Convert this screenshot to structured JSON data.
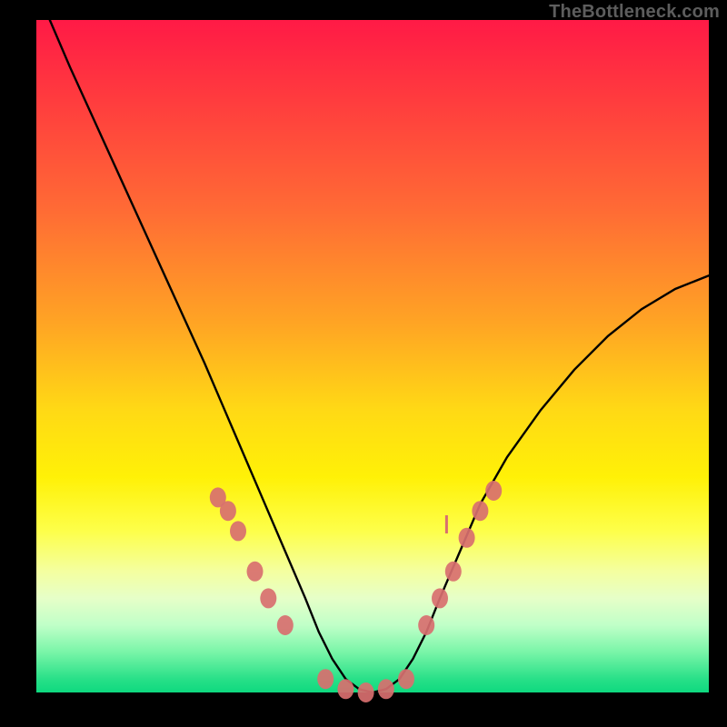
{
  "watermark": "TheBottleneck.com",
  "colors": {
    "frame": "#000000",
    "curve": "#000000",
    "marker": "#d86f6f",
    "gradient_top": "#ff1a46",
    "gradient_mid": "#ffe210",
    "gradient_bottom": "#0ed97f"
  },
  "chart_data": {
    "type": "line",
    "title": "",
    "xlabel": "",
    "ylabel": "",
    "xlim": [
      0,
      100
    ],
    "ylim": [
      0,
      100
    ],
    "grid": false,
    "legend": false,
    "series": [
      {
        "name": "bottleneck-curve",
        "x": [
          2,
          5,
          10,
          15,
          20,
          25,
          28,
          31,
          34,
          37,
          40,
          42,
          44,
          46,
          48,
          50,
          52,
          54,
          56,
          58,
          60,
          63,
          66,
          70,
          75,
          80,
          85,
          90,
          95,
          100
        ],
        "values": [
          100,
          93,
          82,
          71,
          60,
          49,
          42,
          35,
          28,
          21,
          14,
          9,
          5,
          2,
          0.5,
          0,
          0.5,
          2,
          5,
          9,
          14,
          21,
          28,
          35,
          42,
          48,
          53,
          57,
          60,
          62
        ]
      }
    ],
    "markers": [
      {
        "name": "left-cluster",
        "x": [
          27,
          28.5,
          30,
          32.5,
          34.5,
          37
        ],
        "y": [
          29,
          27,
          24,
          18,
          14,
          10
        ]
      },
      {
        "name": "trough",
        "x": [
          43,
          46,
          49,
          52,
          55
        ],
        "y": [
          2,
          0.5,
          0,
          0.5,
          2
        ]
      },
      {
        "name": "right-cluster",
        "x": [
          58,
          60,
          62,
          64,
          66,
          68
        ],
        "y": [
          10,
          14,
          18,
          23,
          27,
          30
        ]
      }
    ],
    "annotations": [
      {
        "name": "tick",
        "x": 61,
        "y": 25,
        "glyph": "vertical-bar"
      }
    ]
  }
}
